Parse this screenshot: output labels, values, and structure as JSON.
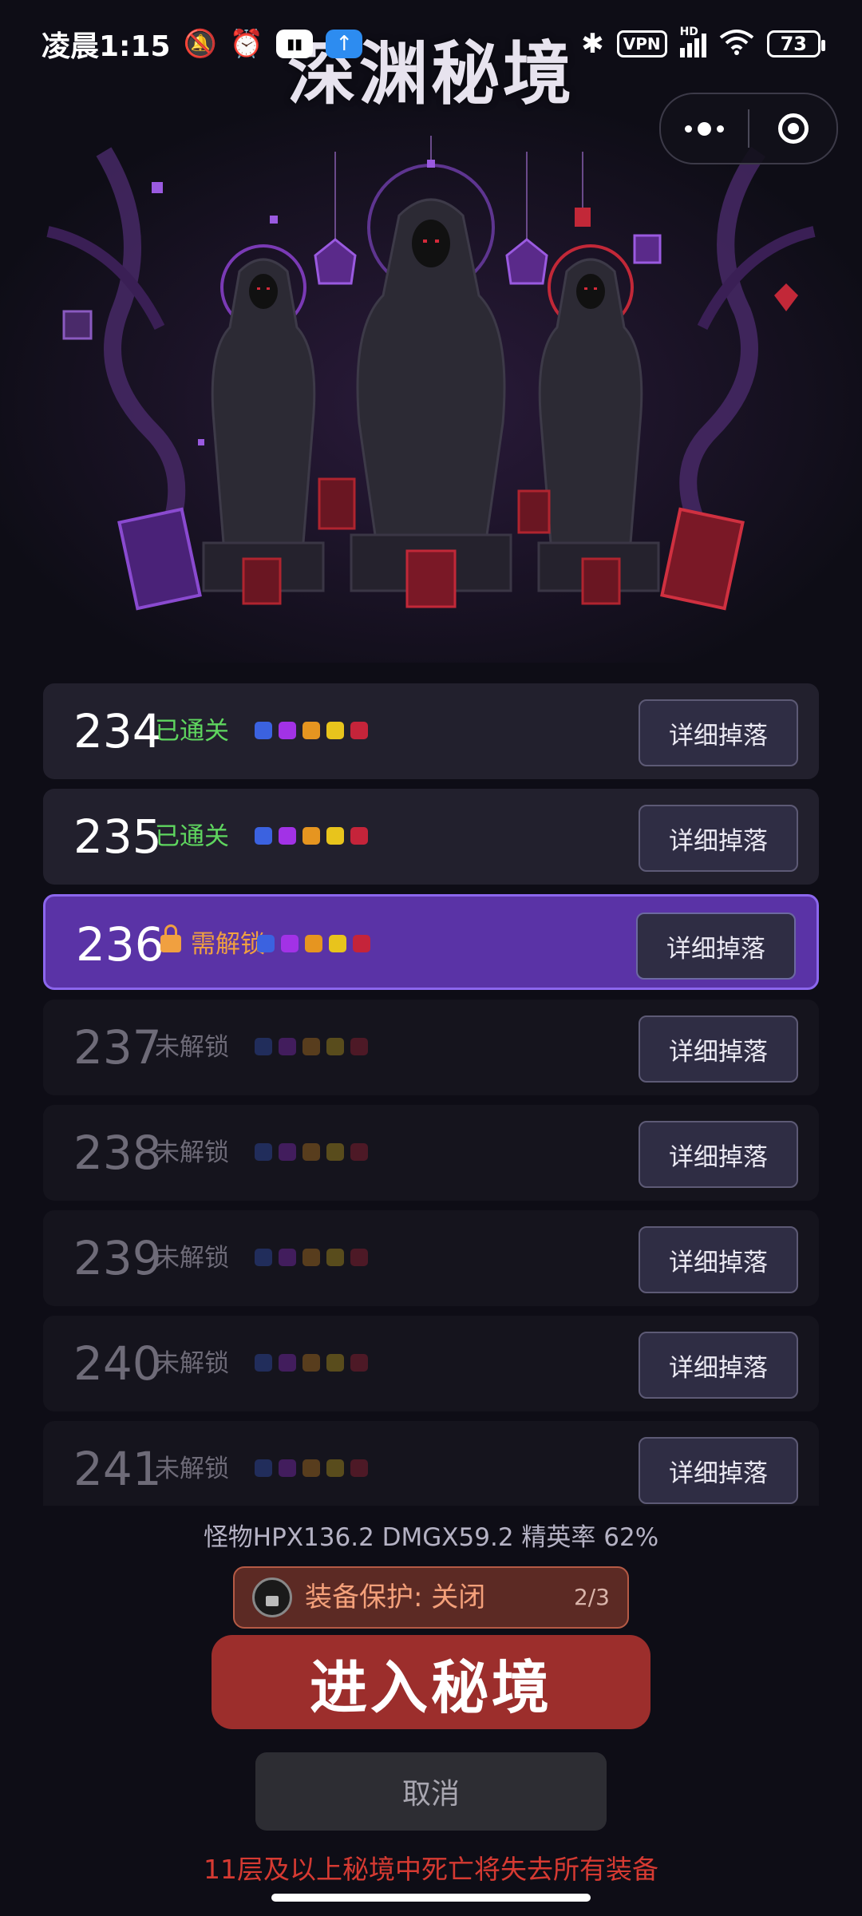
{
  "status_bar": {
    "time": "凌晨1:15",
    "vpn": "VPN",
    "hd": "HD",
    "battery": "73",
    "icons": [
      "mute-bell-icon",
      "alarm-icon",
      "nfc-icon",
      "upload-icon",
      "bluetooth-icon",
      "signal-icon",
      "wifi-icon"
    ]
  },
  "header": {
    "title": "深渊秘境"
  },
  "levels": [
    {
      "number": "234",
      "status": "已通关",
      "state": "cleared",
      "detail": "详细掉落"
    },
    {
      "number": "235",
      "status": "已通关",
      "state": "cleared",
      "detail": "详细掉落"
    },
    {
      "number": "236",
      "status": "需解锁",
      "state": "current",
      "detail": "详细掉落"
    },
    {
      "number": "237",
      "status": "未解锁",
      "state": "locked",
      "detail": "详细掉落"
    },
    {
      "number": "238",
      "status": "未解锁",
      "state": "locked",
      "detail": "详细掉落"
    },
    {
      "number": "239",
      "status": "未解锁",
      "state": "locked",
      "detail": "详细掉落"
    },
    {
      "number": "240",
      "status": "未解锁",
      "state": "locked",
      "detail": "详细掉落"
    },
    {
      "number": "241",
      "status": "未解锁",
      "state": "locked",
      "detail": "详细掉落"
    }
  ],
  "rarity_colors": [
    "#3b62e0",
    "#a232e6",
    "#e69520",
    "#e8c41c",
    "#c5243a"
  ],
  "stats_text": "怪物HPX136.2 DMGX59.2 精英率 62%",
  "protection": {
    "label": "装备保护: 关闭",
    "count": "2/3"
  },
  "enter_button": "进入秘境",
  "cancel_button": "取消",
  "warning": "11层及以上秘境中死亡将失去所有装备"
}
